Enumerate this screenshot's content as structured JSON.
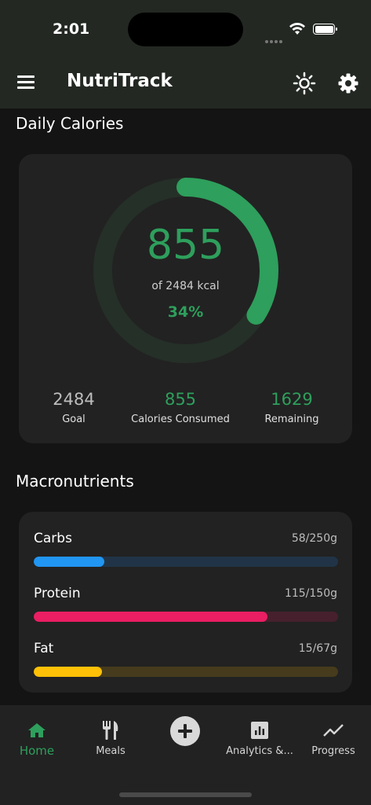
{
  "status_bar": {
    "time": "2:01"
  },
  "header": {
    "title": "NutriTrack"
  },
  "calories": {
    "section_title": "Daily Calories",
    "consumed": "855",
    "goal_text": "of 2484 kcal",
    "percent_text": "34%",
    "progress": 0.34,
    "stats": [
      {
        "value": "2484",
        "label": "Goal"
      },
      {
        "value": "855",
        "label": "Calories Consumed"
      },
      {
        "value": "1629",
        "label": "Remaining"
      }
    ]
  },
  "macros": {
    "section_title": "Macronutrients",
    "items": [
      {
        "name": "Carbs",
        "value": "58/250g",
        "progress": 0.232,
        "color": "#2196f3",
        "track": "#213447"
      },
      {
        "name": "Protein",
        "value": "115/150g",
        "progress": 0.767,
        "color": "#e91e63",
        "track": "#46202d"
      },
      {
        "name": "Fat",
        "value": "15/67g",
        "progress": 0.224,
        "color": "#ffc107",
        "track": "#463b1c"
      }
    ]
  },
  "nav": {
    "items": [
      {
        "label": "Home",
        "icon": "home-icon",
        "active": true
      },
      {
        "label": "Meals",
        "icon": "fork-knife-icon"
      },
      {
        "label": "",
        "icon": "add-circle-icon"
      },
      {
        "label": "Analytics &...",
        "icon": "analytics-icon"
      },
      {
        "label": "Progress",
        "icon": "trend-icon"
      }
    ]
  },
  "colors": {
    "accent_green": "#2e9f5c",
    "ring_track": "#253028",
    "stat_goal": "#bdbdbd"
  }
}
